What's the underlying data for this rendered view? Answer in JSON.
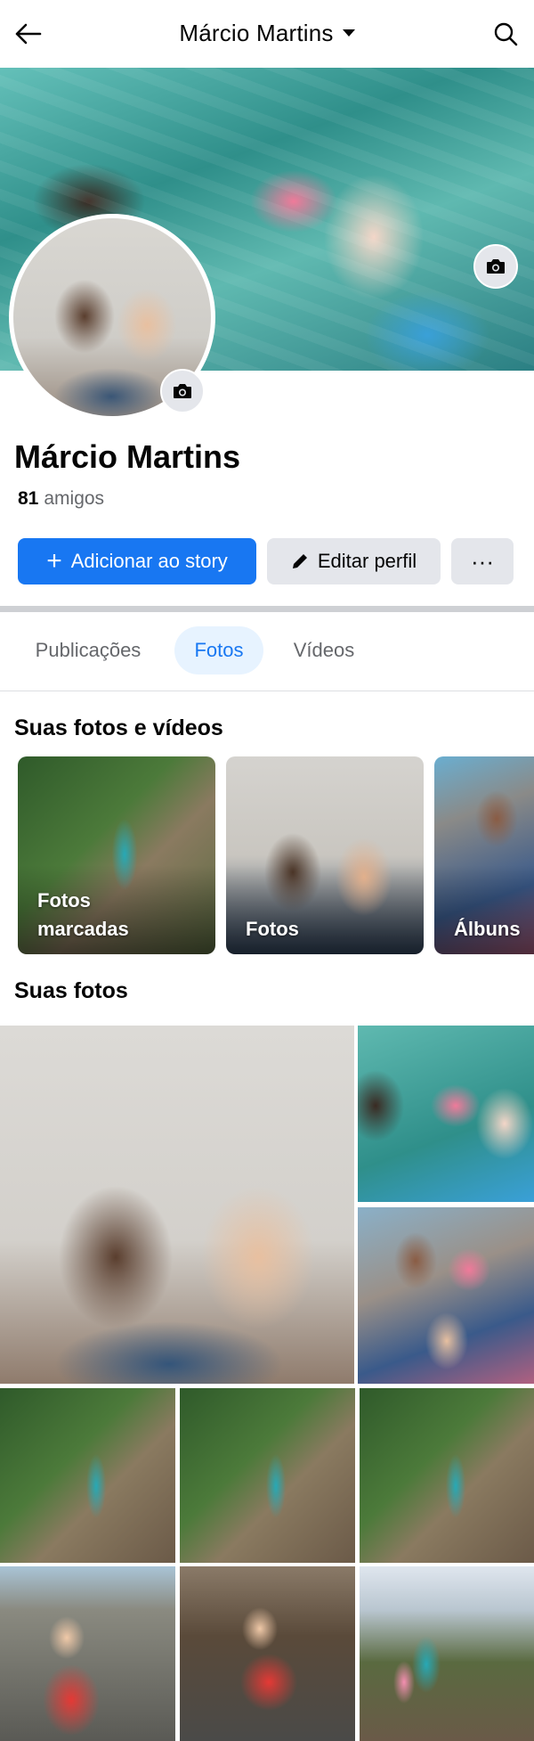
{
  "header": {
    "title": "Márcio Martins",
    "back_icon": "arrow-left-icon",
    "search_icon": "search-icon"
  },
  "profile": {
    "name": "Márcio Martins",
    "friends_count": "81",
    "friends_label": "amigos"
  },
  "actions": {
    "add_story": "Adicionar ao story",
    "edit_profile": "Editar perfil",
    "more": "···"
  },
  "tabs": [
    {
      "label": "Publicações",
      "active": false
    },
    {
      "label": "Fotos",
      "active": true
    },
    {
      "label": "Vídeos",
      "active": false
    }
  ],
  "sections": {
    "photos_videos_title": "Suas fotos e vídeos",
    "your_photos_title": "Suas fotos"
  },
  "cards": [
    {
      "label": "Fotos marcadas"
    },
    {
      "label": "Fotos"
    },
    {
      "label": "Álbuns"
    }
  ],
  "colors": {
    "accent": "#1877f2",
    "tab_active_bg": "#e7f3ff",
    "button_gray": "#e4e6eb",
    "secondary_text": "#65676b"
  }
}
